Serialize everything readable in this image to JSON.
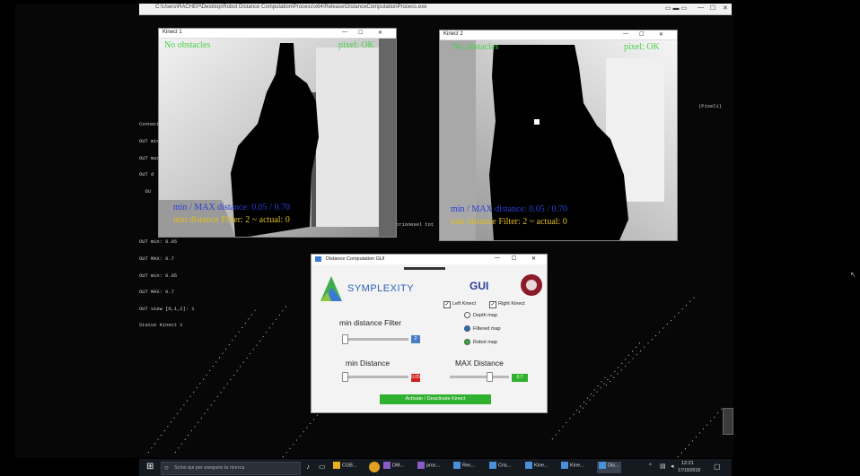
{
  "console": {
    "title_path": "C:\\Users\\RACHEP\\Desktop\\Robot Distance Computation\\Process\\x64\\Release\\DistanceComputationProcess.exe",
    "right_label": "(Pixel1)",
    "log_lines": [
      "Connected",
      "OUT min",
      "OUT max",
      "OUT d",
      "  OU"
    ],
    "status_lines": [
      "OUT min: 0.05",
      "OUT MAX: 0.7",
      "OUT min: 0.05",
      "OUT MAX: 0.7",
      "OUT view [0,1,2]: 1",
      "Status Kinect 1"
    ],
    "mid_label": "orionesel tot"
  },
  "kinect1": {
    "title": "Kinect 1",
    "no_obstacles": "No obstacles",
    "pixel_ok": "pixel: OK",
    "distance_line": "min / MAX distance: 0.05 / 0.70",
    "filter_line": "min distance Filter: 2 ~ actual: 0"
  },
  "kinect2": {
    "title": "Kinect 2",
    "no_obstacles": "No obstacles",
    "pixel_ok": "pixel: OK",
    "distance_line": "min / MAX distance: 0.05 / 0.70",
    "filter_line": "min distance Filter: 2 ~ actual: 0"
  },
  "gui": {
    "window_title": "Distance Computation GUI",
    "brand": "SYMPLEXITY",
    "heading": "GUI",
    "left_kinect": "Left Kinect",
    "right_kinect": "Right Kinect",
    "radio_depth": "Depth map",
    "radio_filtered": "Filtered map",
    "radio_robot": "Robot map",
    "min_filter_label": "min distance Filter",
    "min_filter_value": "2",
    "min_distance_label": "min Distance",
    "min_distance_value": "0.05",
    "max_distance_label": "MAX Distance",
    "max_distance_value": "0.7",
    "action_button": "Activate / Deactivate Kinect",
    "colors": {
      "filter_box": "#4a7fc8",
      "min_box": "#d02020",
      "max_box": "#2fb02f",
      "button": "#2fb02f"
    }
  },
  "taskbar": {
    "search": "Scrivi qui per eseguire la ricerca",
    "items": [
      "CGB...",
      "DM...",
      "proc...",
      "Rec...",
      "Cris...",
      "Kine...",
      "Kine...",
      "Dis..."
    ],
    "time": "12:21",
    "date": "17/10/2018"
  }
}
